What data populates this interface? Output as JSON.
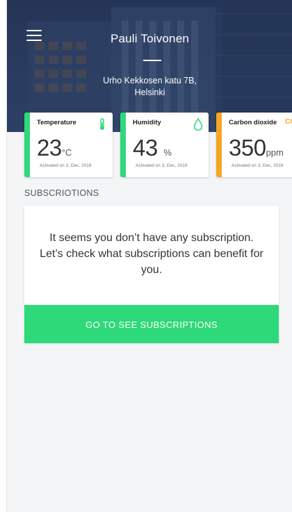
{
  "header": {
    "user_name": "Pauli Toivonen",
    "address_line1": "Urho Kekkosen katu 7B,",
    "address_line2": "Helsinki"
  },
  "sensors": [
    {
      "label": "Temperature",
      "value": "23",
      "unit": "°C",
      "activated": "Activated on 3, Dec, 2018",
      "icon": "thermometer-icon",
      "color": "#2ed97a"
    },
    {
      "label": "Humidity",
      "value": "43",
      "unit": "%",
      "activated": "Activated on 3, Dec, 2018",
      "icon": "water-drop-icon",
      "color": "#2ed97a"
    },
    {
      "label": "Carbon dioxide",
      "value": "350",
      "unit": "ppm",
      "activated": "Activated on 3, Dec, 2018",
      "icon": "co2-icon",
      "icon_text": "CO",
      "color": "#f5a623"
    }
  ],
  "subscriptions": {
    "title": "SUBSCRIOTIONS",
    "message": "It seems you don’t have any subscription. Let’s check what subscriptions can benefit for you.",
    "button_label": "GO TO SEE SUBSCRIPTIONS"
  },
  "colors": {
    "accent": "#2ed97a",
    "warning": "#f5a623",
    "header": "#2c3e63"
  }
}
